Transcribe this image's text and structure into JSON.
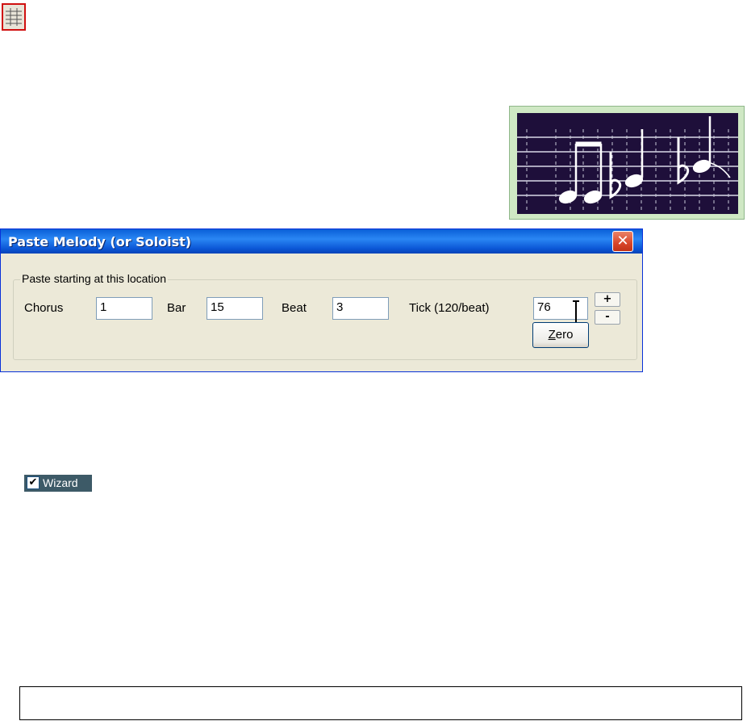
{
  "icons": {
    "grid": "grid-icon",
    "close": "close-icon",
    "notation": "music-notation-icon"
  },
  "colors": {
    "titlebar": "#0a5fd8",
    "dialog_bg": "#ece9d8",
    "close_red": "#d8452a",
    "notation_bg": "#1e0f3a",
    "notation_frame": "#cfe8c4",
    "wizard_bg": "#3d5a67"
  },
  "dialog": {
    "title": "Paste Melody (or Soloist)",
    "close_label": "✕",
    "group_label": "Paste starting at this location",
    "fields": {
      "chorus": {
        "label": "Chorus",
        "value": "1"
      },
      "bar": {
        "label": "Bar",
        "value": "15"
      },
      "beat": {
        "label": "Beat",
        "value": "3"
      },
      "tick": {
        "label": "Tick (120/beat)",
        "value": "76"
      }
    },
    "plus_label": "+",
    "minus_label": "-",
    "zero_first": "Z",
    "zero_rest": "ero"
  },
  "wizard": {
    "checked": true,
    "check_mark": "✔",
    "label": "Wizard"
  }
}
